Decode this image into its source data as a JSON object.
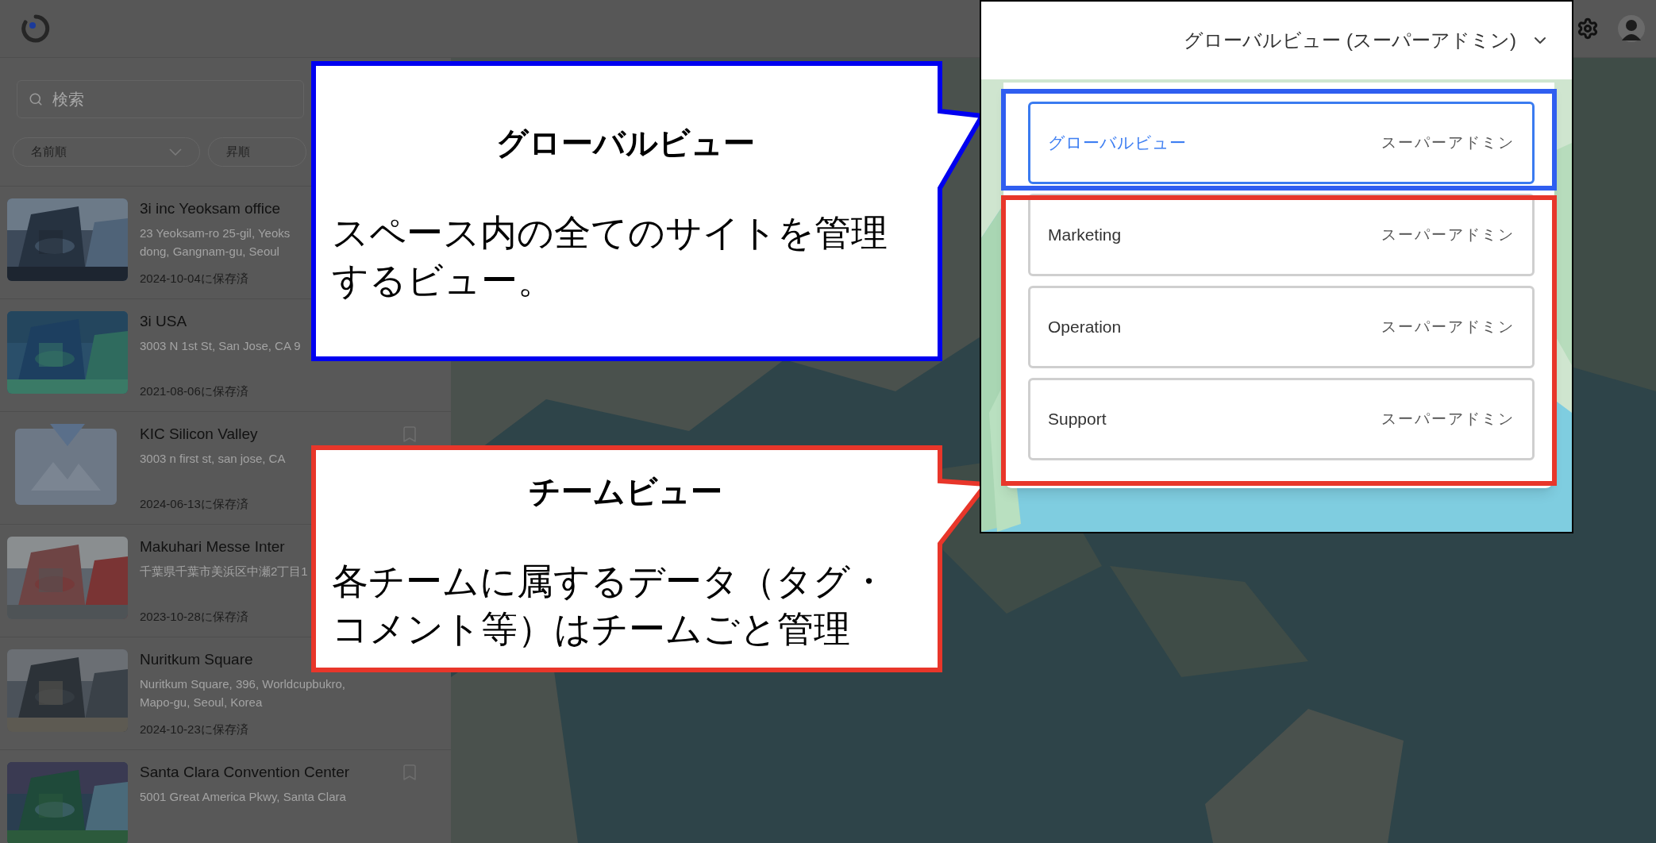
{
  "app_bar": {
    "view_selector": {
      "label": "グローバルビュー (スーパーアドミン)"
    }
  },
  "sidebar": {
    "search": {
      "placeholder": "検索"
    },
    "sort": [
      {
        "label": "名前順",
        "kind": "dropdown"
      },
      {
        "label": "昇順",
        "kind": "toggle"
      }
    ],
    "sites": [
      {
        "title": "3i inc Yeoksam office",
        "address_lines": [
          "23 Yeoksam-ro 25-gil, Yeoks",
          "dong, Gangnam-gu, Seoul"
        ],
        "saved": "2024-10-04に保存済"
      },
      {
        "title": "3i USA",
        "address_lines": [
          "3003 N 1st St, San Jose, CA 9"
        ],
        "saved": "2021-08-06に保存済"
      },
      {
        "title": "KIC Silicon Valley",
        "address_lines": [
          "3003 n first st, san jose, CA"
        ],
        "saved": "2024-06-13に保存済",
        "kind": "placeholder",
        "bookmark": {
          "filled": false
        }
      },
      {
        "title": "Makuhari Messe Inter",
        "address_lines": [
          "千葉県千葉市美浜区中瀬2丁目1"
        ],
        "saved": "2023-10-28に保存済"
      },
      {
        "title": "Nuritkum Square",
        "address_lines": [
          "Nuritkum Square, 396, Worldcupbukro,",
          "Mapo-gu, Seoul, Korea"
        ],
        "saved": "2024-10-23に保存済"
      },
      {
        "title": "Santa Clara Convention Center",
        "address_lines": [
          "5001 Great America Pkwy, Santa Clara"
        ],
        "bookmark": {
          "filled": false
        }
      }
    ]
  },
  "view_menu": {
    "items": [
      {
        "label": "グローバルビュー",
        "role": "スーパーアドミン",
        "selected": true
      },
      {
        "label": "Marketing",
        "role": "スーパーアドミン",
        "selected": false
      },
      {
        "label": "Operation",
        "role": "スーパーアドミン",
        "selected": false
      },
      {
        "label": "Support",
        "role": "スーパーアドミン",
        "selected": false
      }
    ],
    "highlights": [
      {
        "color": "#2f5ef0"
      },
      {
        "color": "#e8362a"
      }
    ]
  },
  "callouts": [
    {
      "title": "グローバルビュー",
      "body": "スペース内の全てのサイトを管理するビュー。",
      "color": "#0000f0"
    },
    {
      "title": "チームビュー",
      "body": "各チームに属するデータ（タグ・コメント等）はチームごと管理",
      "color": "#e8362a"
    }
  ]
}
